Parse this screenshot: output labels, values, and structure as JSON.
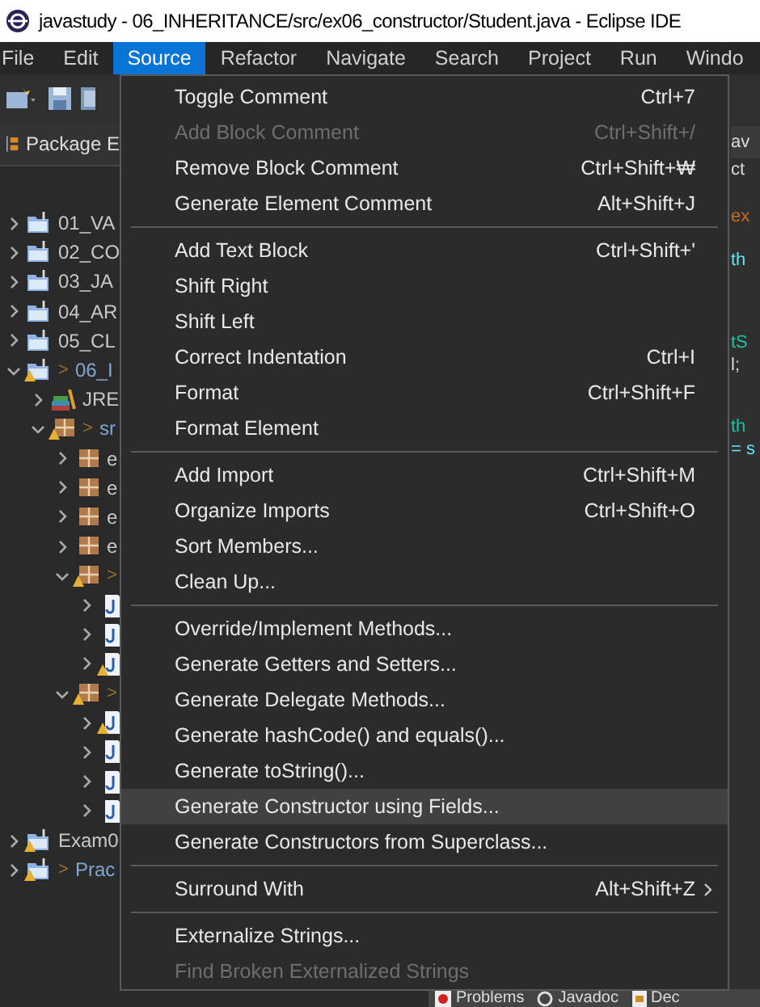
{
  "window": {
    "title": "javastudy - 06_INHERITANCE/src/ex06_constructor/Student.java - Eclipse IDE"
  },
  "menu_bar": [
    {
      "label": "File",
      "selected": false
    },
    {
      "label": "Edit",
      "selected": false
    },
    {
      "label": "Source",
      "selected": true
    },
    {
      "label": "Refactor",
      "selected": false
    },
    {
      "label": "Navigate",
      "selected": false
    },
    {
      "label": "Search",
      "selected": false
    },
    {
      "label": "Project",
      "selected": false
    },
    {
      "label": "Run",
      "selected": false
    },
    {
      "label": "Windo",
      "selected": false
    }
  ],
  "view_tab": {
    "label": "Package E"
  },
  "tree": [
    {
      "kind": "project",
      "label": "01_VA",
      "expanded": false,
      "warning": false
    },
    {
      "kind": "project",
      "label": "02_CO",
      "expanded": false,
      "warning": false
    },
    {
      "kind": "project",
      "label": "03_JA",
      "expanded": false,
      "warning": false
    },
    {
      "kind": "project",
      "label": "04_AR",
      "expanded": false,
      "warning": false
    },
    {
      "kind": "project",
      "label": "05_CL",
      "expanded": false,
      "warning": false
    },
    {
      "kind": "project",
      "marker": ">",
      "label": "06_I",
      "expanded": true,
      "warning": true,
      "children": [
        {
          "kind": "library",
          "label": "JRE",
          "expanded": false,
          "warning": false
        },
        {
          "kind": "source-folder",
          "marker": ">",
          "label": "sr",
          "expanded": true,
          "warning": true,
          "children": [
            {
              "kind": "package",
              "label": "e",
              "expanded": false,
              "warning": false
            },
            {
              "kind": "package",
              "label": "e",
              "expanded": false,
              "warning": false
            },
            {
              "kind": "package",
              "label": "e",
              "expanded": false,
              "warning": false
            },
            {
              "kind": "package",
              "label": "e",
              "expanded": false,
              "warning": false
            },
            {
              "kind": "package",
              "marker": ">",
              "expanded": true,
              "warning": true,
              "children": [
                {
                  "kind": "java-file",
                  "expanded": false,
                  "warning": false
                },
                {
                  "kind": "java-file",
                  "expanded": false,
                  "warning": false
                },
                {
                  "kind": "java-file",
                  "expanded": false,
                  "warning": true
                }
              ]
            },
            {
              "kind": "package",
              "marker": ">",
              "expanded": true,
              "warning": true,
              "children": [
                {
                  "kind": "java-file",
                  "expanded": false,
                  "warning": true
                },
                {
                  "kind": "java-file",
                  "expanded": false,
                  "warning": false
                },
                {
                  "kind": "java-file",
                  "expanded": false,
                  "warning": false
                },
                {
                  "kind": "java-file",
                  "expanded": false,
                  "warning": false
                }
              ]
            }
          ]
        }
      ]
    },
    {
      "kind": "project",
      "label": "Exam0",
      "expanded": false,
      "warning": true
    },
    {
      "kind": "project",
      "marker": ">",
      "label": "Prac",
      "expanded": false,
      "warning": true
    }
  ],
  "editor": {
    "tab": "av",
    "lines": [
      {
        "text": "ct",
        "kind": "plain"
      },
      {
        "text": "ex",
        "kind": "keyword"
      },
      {
        "text": "th",
        "kind": "field"
      },
      {
        "text": "tS",
        "kind": "comment"
      },
      {
        "text": "l;",
        "kind": "plain"
      },
      {
        "text": "th",
        "kind": "comment"
      },
      {
        "text": "= s",
        "kind": "field"
      }
    ]
  },
  "source_menu": [
    {
      "kind": "item",
      "label": "Toggle Comment",
      "shortcut": "Ctrl+7",
      "disabled": false,
      "highlighted": false
    },
    {
      "kind": "item",
      "label": "Add Block Comment",
      "shortcut": "Ctrl+Shift+/",
      "disabled": true,
      "highlighted": false
    },
    {
      "kind": "item",
      "label": "Remove Block Comment",
      "shortcut": "Ctrl+Shift+₩",
      "disabled": false,
      "highlighted": false
    },
    {
      "kind": "item",
      "label": "Generate Element Comment",
      "shortcut": "Alt+Shift+J",
      "disabled": false,
      "highlighted": false
    },
    {
      "kind": "separator"
    },
    {
      "kind": "item",
      "label": "Add Text Block",
      "shortcut": "Ctrl+Shift+'",
      "disabled": false,
      "highlighted": false
    },
    {
      "kind": "item",
      "label": "Shift Right",
      "disabled": false,
      "highlighted": false
    },
    {
      "kind": "item",
      "label": "Shift Left",
      "disabled": false,
      "highlighted": false
    },
    {
      "kind": "item",
      "label": "Correct Indentation",
      "shortcut": "Ctrl+I",
      "disabled": false,
      "highlighted": false
    },
    {
      "kind": "item",
      "label": "Format",
      "shortcut": "Ctrl+Shift+F",
      "disabled": false,
      "highlighted": false
    },
    {
      "kind": "item",
      "label": "Format Element",
      "disabled": false,
      "highlighted": false
    },
    {
      "kind": "separator"
    },
    {
      "kind": "item",
      "label": "Add Import",
      "shortcut": "Ctrl+Shift+M",
      "disabled": false,
      "highlighted": false
    },
    {
      "kind": "item",
      "label": "Organize Imports",
      "shortcut": "Ctrl+Shift+O",
      "disabled": false,
      "highlighted": false
    },
    {
      "kind": "item",
      "label": "Sort Members...",
      "disabled": false,
      "highlighted": false
    },
    {
      "kind": "item",
      "label": "Clean Up...",
      "disabled": false,
      "highlighted": false
    },
    {
      "kind": "separator"
    },
    {
      "kind": "item",
      "label": "Override/Implement Methods...",
      "disabled": false,
      "highlighted": false
    },
    {
      "kind": "item",
      "label": "Generate Getters and Setters...",
      "disabled": false,
      "highlighted": false
    },
    {
      "kind": "item",
      "label": "Generate Delegate Methods...",
      "disabled": false,
      "highlighted": false
    },
    {
      "kind": "item",
      "label": "Generate hashCode() and equals()...",
      "disabled": false,
      "highlighted": false
    },
    {
      "kind": "item",
      "label": "Generate toString()...",
      "disabled": false,
      "highlighted": false
    },
    {
      "kind": "item",
      "label": "Generate Constructor using Fields...",
      "disabled": false,
      "highlighted": true
    },
    {
      "kind": "item",
      "label": "Generate Constructors from Superclass...",
      "disabled": false,
      "highlighted": false
    },
    {
      "kind": "separator"
    },
    {
      "kind": "submenu",
      "label": "Surround With",
      "shortcut": "Alt+Shift+Z",
      "disabled": false,
      "highlighted": false
    },
    {
      "kind": "separator"
    },
    {
      "kind": "item",
      "label": "Externalize Strings...",
      "disabled": false,
      "highlighted": false
    },
    {
      "kind": "item",
      "label": "Find Broken Externalized Strings",
      "disabled": true,
      "highlighted": false
    }
  ],
  "bottom_tabs": [
    {
      "label": "Problems",
      "kind": "problems"
    },
    {
      "label": "Javadoc",
      "kind": "javadoc"
    },
    {
      "label": "Dec",
      "kind": "declaration"
    }
  ]
}
